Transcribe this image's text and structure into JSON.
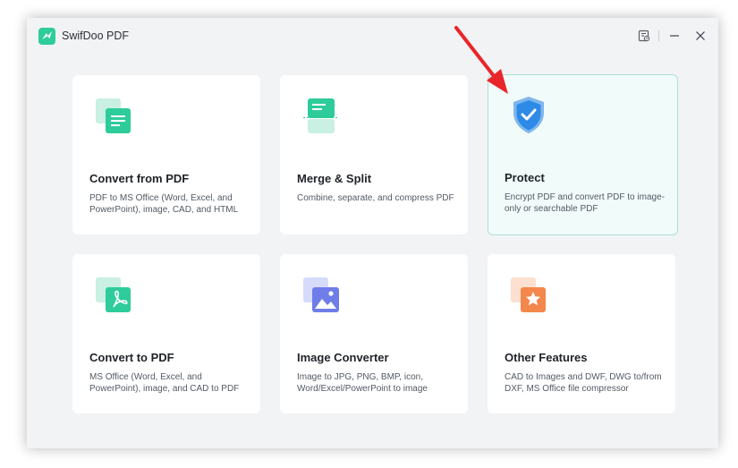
{
  "app": {
    "title": "SwifDoo PDF",
    "colors": {
      "accent": "#2ecc9a",
      "window_bg": "#f2f3f5",
      "card_bg": "#ffffff",
      "active_card_bg": "#f1fbfa",
      "active_card_border": "#a9e3d6",
      "arrow": "#e8262a"
    }
  },
  "titlebar": {
    "icons": [
      "history-icon",
      "minimize-icon",
      "close-icon"
    ]
  },
  "cards": [
    {
      "title": "Convert from PDF",
      "desc": "PDF to MS Office (Word, Excel, and PowerPoint), image, CAD, and HTML",
      "icon": "convert-from-pdf-icon"
    },
    {
      "title": "Merge & Split",
      "desc": "Combine, separate, and compress PDF",
      "icon": "merge-split-icon"
    },
    {
      "title": "Protect",
      "desc": "Encrypt PDF and convert PDF to image-only or searchable PDF",
      "icon": "shield-check-icon"
    },
    {
      "title": "Convert to PDF",
      "desc": "MS Office (Word, Excel, and PowerPoint), image, and CAD to PDF",
      "icon": "convert-to-pdf-icon"
    },
    {
      "title": "Image Converter",
      "desc": "Image to JPG, PNG, BMP, icon, Word/Excel/PowerPoint to image",
      "icon": "image-icon"
    },
    {
      "title": "Other Features",
      "desc": "CAD to Images and DWF, DWG to/from DXF, MS Office file compressor",
      "icon": "star-icon"
    }
  ]
}
